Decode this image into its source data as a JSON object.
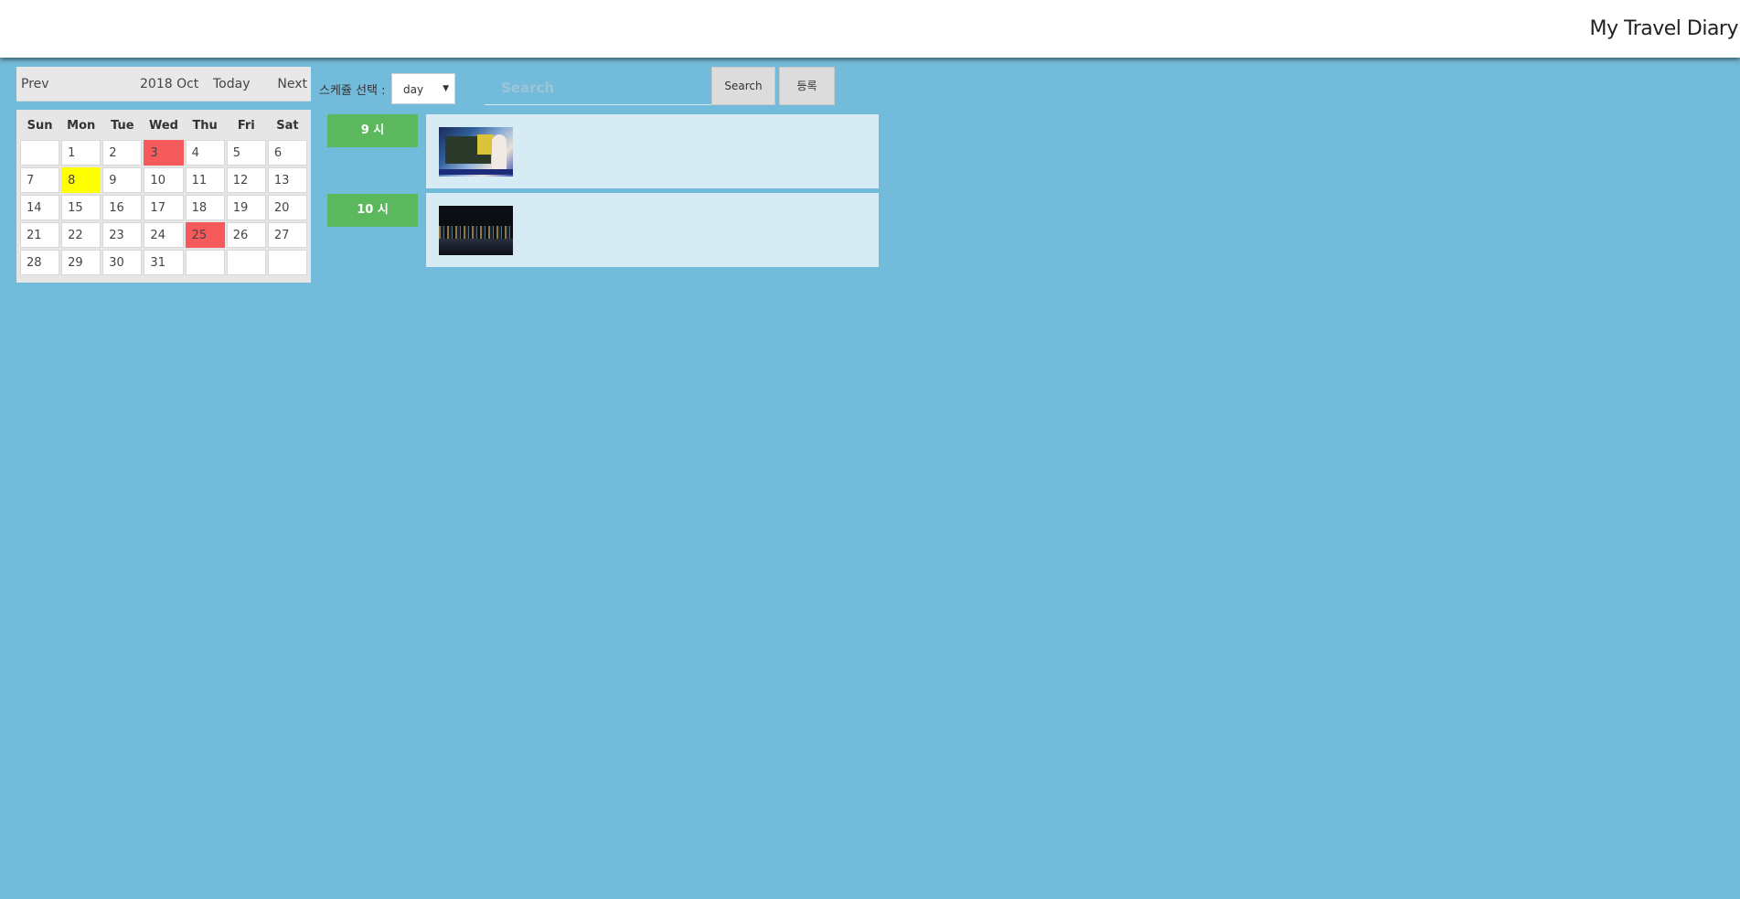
{
  "header": {
    "title": "My Travel Diary"
  },
  "calendar": {
    "nav": {
      "prev": "Prev",
      "month": "2018 Oct",
      "today": "Today",
      "next": "Next"
    },
    "weekdays": [
      "Sun",
      "Mon",
      "Tue",
      "Wed",
      "Thu",
      "Fri",
      "Sat"
    ],
    "weeks": [
      [
        "",
        "1",
        "2",
        "3",
        "4",
        "5",
        "6"
      ],
      [
        "7",
        "8",
        "9",
        "10",
        "11",
        "12",
        "13"
      ],
      [
        "14",
        "15",
        "16",
        "17",
        "18",
        "19",
        "20"
      ],
      [
        "21",
        "22",
        "23",
        "24",
        "25",
        "26",
        "27"
      ],
      [
        "28",
        "29",
        "30",
        "31",
        "",
        "",
        ""
      ]
    ],
    "highlight_red_days": [
      "3",
      "25"
    ],
    "highlight_today": "8",
    "colors": {
      "red": "#f75a5a",
      "today": "#ffff00"
    }
  },
  "controls": {
    "schedule_label": "스케쥴 선택 :",
    "schedule_select_value": "day",
    "search_placeholder": "Search",
    "search_button": "Search",
    "register_button": "등록"
  },
  "schedule": [
    {
      "hour": "9 시",
      "image": "travel-photo-tv-screen"
    },
    {
      "hour": "10 시",
      "image": "travel-photo-night-city"
    }
  ],
  "colors": {
    "background": "#73bbda",
    "hour_badge": "#5cb85c",
    "entry_bg": "#d6ebf4"
  }
}
